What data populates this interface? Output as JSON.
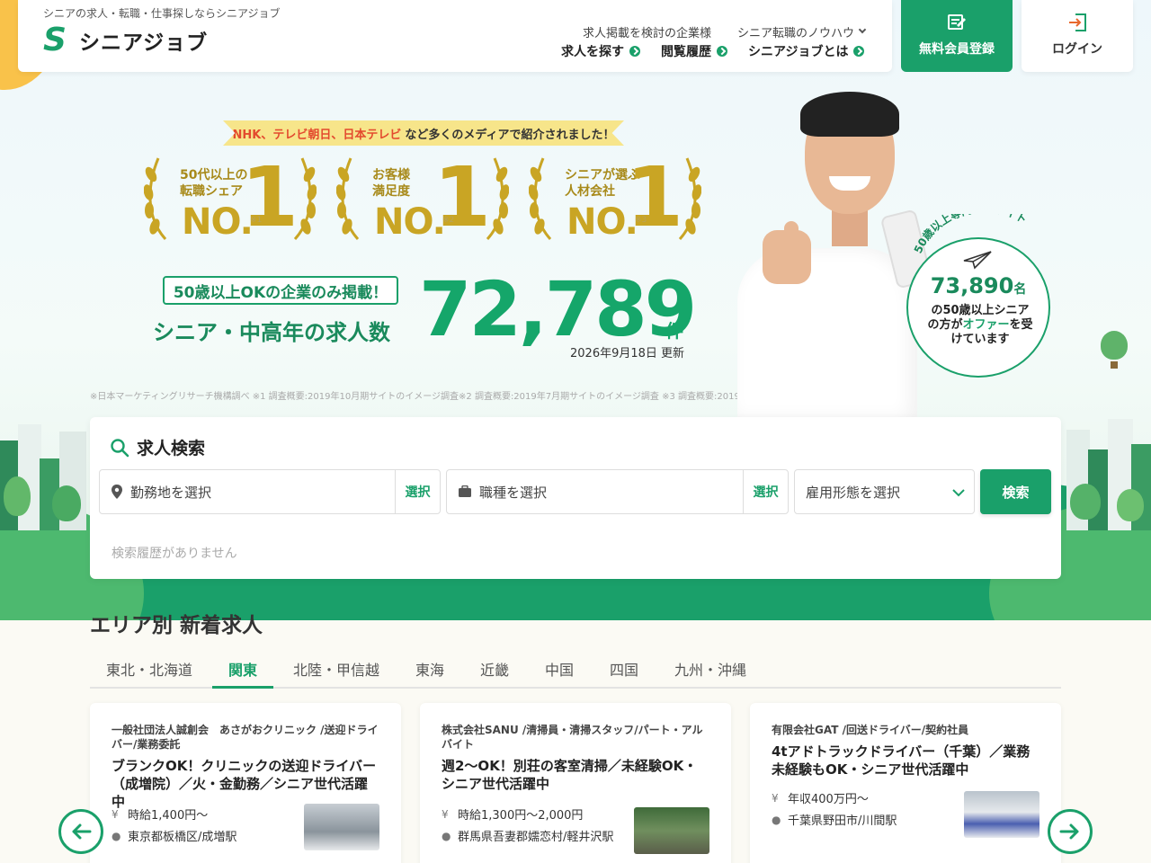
{
  "header": {
    "tagline": "シニアの求人・転職・仕事探しならシニアジョブ",
    "logo_mark": "S",
    "logo_text": "シニアジョブ",
    "nav_sub": [
      "求人掲載を検討の企業様",
      "シニア転職のノウハウ"
    ],
    "nav_main": [
      "求人を探す",
      "閲覧履歴",
      "シニアジョブとは"
    ],
    "register_label": "無料会員登録",
    "login_label": "ログイン"
  },
  "hero": {
    "media_prefix": "NHK、テレビ朝日、日本テレビ",
    "media_suffix": "など多くのメディアで紹介されました！",
    "awards": [
      {
        "line1": "50代以上の",
        "line2": "転職シェア",
        "no": "NO.",
        "one": "1",
        "note": "※1"
      },
      {
        "line1": "お客様",
        "line2": "満足度",
        "no": "NO.",
        "one": "1",
        "note": "※2"
      },
      {
        "line1": "シニアが選ぶ",
        "line2": "人材会社",
        "no": "NO.",
        "one": "1",
        "note": "※3"
      }
    ],
    "only_badge": "50歳以上OKの企業のみ掲載！",
    "count_label": "シニア・中高年の求人数",
    "count_value": "72,789",
    "count_unit": "件",
    "count_date": "2026年9月18日 更新",
    "footnote": "※日本マーケティングリサーチ機構調べ ※1 調査概要:2019年10月期サイトのイメージ調査※2 調査概要:2019年7月期サイトのイメージ調査 ※3 調査概要:2019年7月期サイトのイメージ調査",
    "circle_arc": "50歳以上専門求人サイト",
    "circle_num": "73,890",
    "circle_unit": "名",
    "circle_text_1": "の50歳以上シニア",
    "circle_text_2": "の方が",
    "circle_text_hl": "オファー",
    "circle_text_3": "を受",
    "circle_text_4": "けています"
  },
  "search": {
    "title": "求人検索",
    "location_placeholder": "勤務地を選択",
    "job_placeholder": "職種を選択",
    "select_label": "選択",
    "employment_placeholder": "雇用形態を選択",
    "search_button": "検索",
    "history_empty": "検索履歴がありません"
  },
  "area": {
    "title": "エリア別 新着求人",
    "tabs": [
      "東北・北海道",
      "関東",
      "北陸・甲信越",
      "東海",
      "近畿",
      "中国",
      "四国",
      "九州・沖縄"
    ],
    "active_tab": "関東",
    "jobs": [
      {
        "company": "一般社団法人誠創会　あさがおクリニック /送迎ドライバー/業務委託",
        "title": "ブランクOK！クリニックの送迎ドライバー（成増院）／火・金勤務／シニア世代活躍中",
        "salary": "時給1,400円〜",
        "location": "東京都板橋区/成増駅"
      },
      {
        "company": "株式会社SANU /清掃員・清掃スタッフ/パート・アルバイト",
        "title": "週2〜OK！別荘の客室清掃／未経験OK・シニア世代活躍中",
        "salary": "時給1,300円〜2,000円",
        "location": "群馬県吾妻郡嬬恋村/軽井沢駅"
      },
      {
        "company": "有限会社GAT /回送ドライバー/契約社員",
        "title": "4tアドトラックドライバー（千葉）／業務未経験もOK・シニア世代活躍中",
        "salary": "年収400万円〜",
        "location": "千葉県野田市/川間駅"
      }
    ]
  },
  "colors": {
    "brand_green": "#1aa06a",
    "gold": "#c9a524",
    "sun": "#f9c24a"
  },
  "icons": [
    "search-icon",
    "pin-icon",
    "briefcase-icon",
    "yen-icon",
    "login-icon",
    "register-icon",
    "paper-plane-icon",
    "arrow-left-icon",
    "arrow-right-icon",
    "chevron-down-icon"
  ]
}
